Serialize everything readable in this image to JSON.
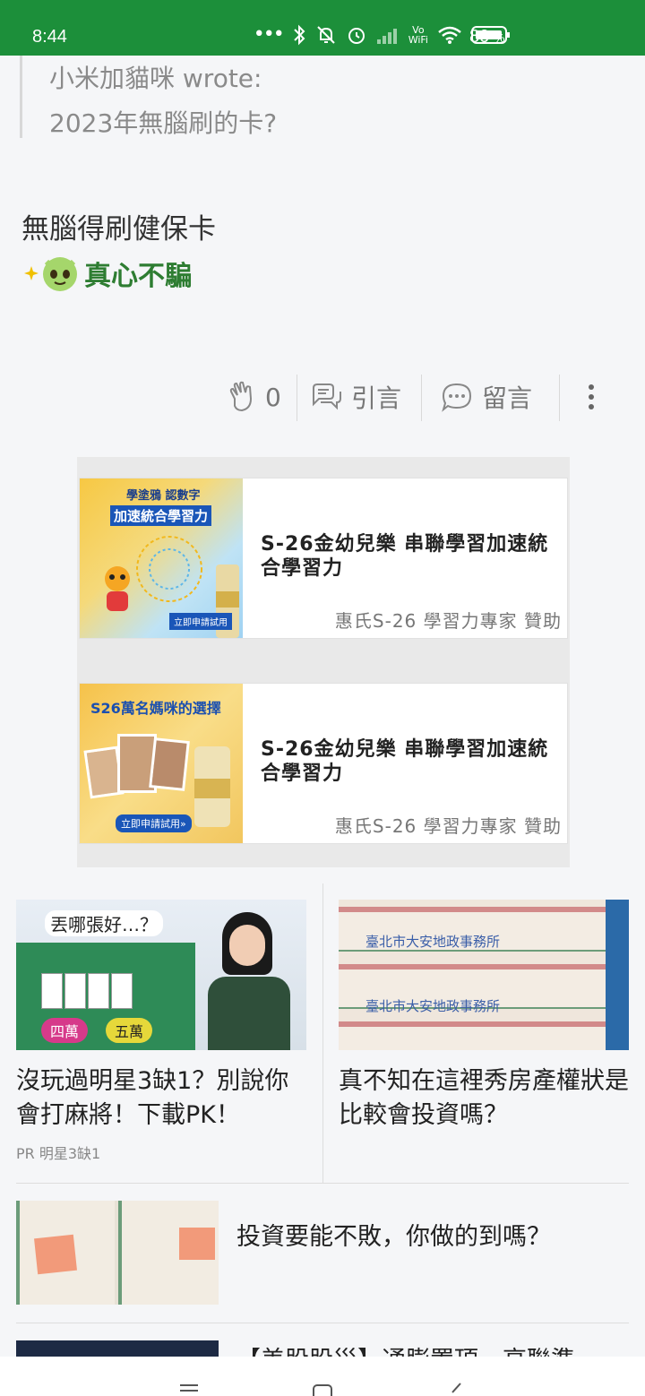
{
  "status_bar": {
    "time": "8:44",
    "battery_percent": "80",
    "battery_unit": "%"
  },
  "quote": {
    "author_line": "小米加貓咪 wrote:",
    "text": "2023年無腦刷的卡?"
  },
  "post": {
    "reply_text": "無腦得刷健保卡",
    "sticker_text": "真心不騙"
  },
  "actions": {
    "like_count": "0",
    "quote_label": "引言",
    "comment_label": "留言"
  },
  "ads": [
    {
      "title": "S-26金幼兒樂 串聯學習加速統合學習力",
      "sponsor": "惠氏S-26 學習力專家 贊助",
      "img": {
        "line1": "學塗鴉 認數字",
        "line2": "加速統合學習力",
        "cta": "立即申請試用"
      }
    },
    {
      "title": "S-26金幼兒樂 串聯學習加速統合學習力",
      "sponsor": "惠氏S-26 學習力專家 贊助",
      "img": {
        "line1": "S26萬名媽咪的選擇",
        "cta": "立即申請試用»"
      }
    }
  ],
  "cards": [
    {
      "title": "沒玩過明星3缺1？別說你會打麻將！下載PK！",
      "pr": "PR 明星3缺1",
      "img": {
        "bubble": "丟哪張好…？",
        "tile_a": "四萬",
        "tile_b": "五萬"
      }
    },
    {
      "title": "真不知在這裡秀房產權狀是比較會投資嗎？",
      "img": {
        "office": "臺北市大安地政事務所"
      }
    }
  ],
  "list_items": [
    {
      "title": "投資要能不敗，你做的到嗎？"
    },
    {
      "title": "【美股股災】通膨置頂、高聯準"
    }
  ],
  "colors": {
    "status_bar": "#1c8f3a",
    "sticker_green": "#2e7d32"
  }
}
